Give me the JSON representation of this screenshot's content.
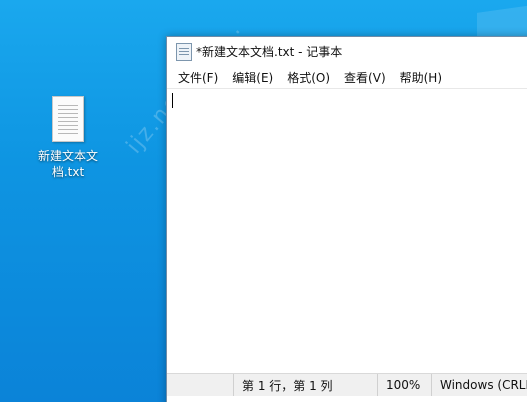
{
  "desktop": {
    "file_label": "新建文本文档.txt",
    "watermark": "ijz.net 菜鸟..."
  },
  "window": {
    "title": "*新建文本文档.txt - 记事本",
    "menu": [
      "文件(F)",
      "编辑(E)",
      "格式(O)",
      "查看(V)",
      "帮助(H)"
    ],
    "editor_text": "",
    "status": {
      "position": "第 1 行，第 1 列",
      "zoom": "100%",
      "line_ending": "Windows (CRLF)"
    }
  },
  "colors": {
    "desktop": "#0e95e2",
    "window_bg": "#ffffff",
    "statusbar_bg": "#f0f0f0"
  }
}
